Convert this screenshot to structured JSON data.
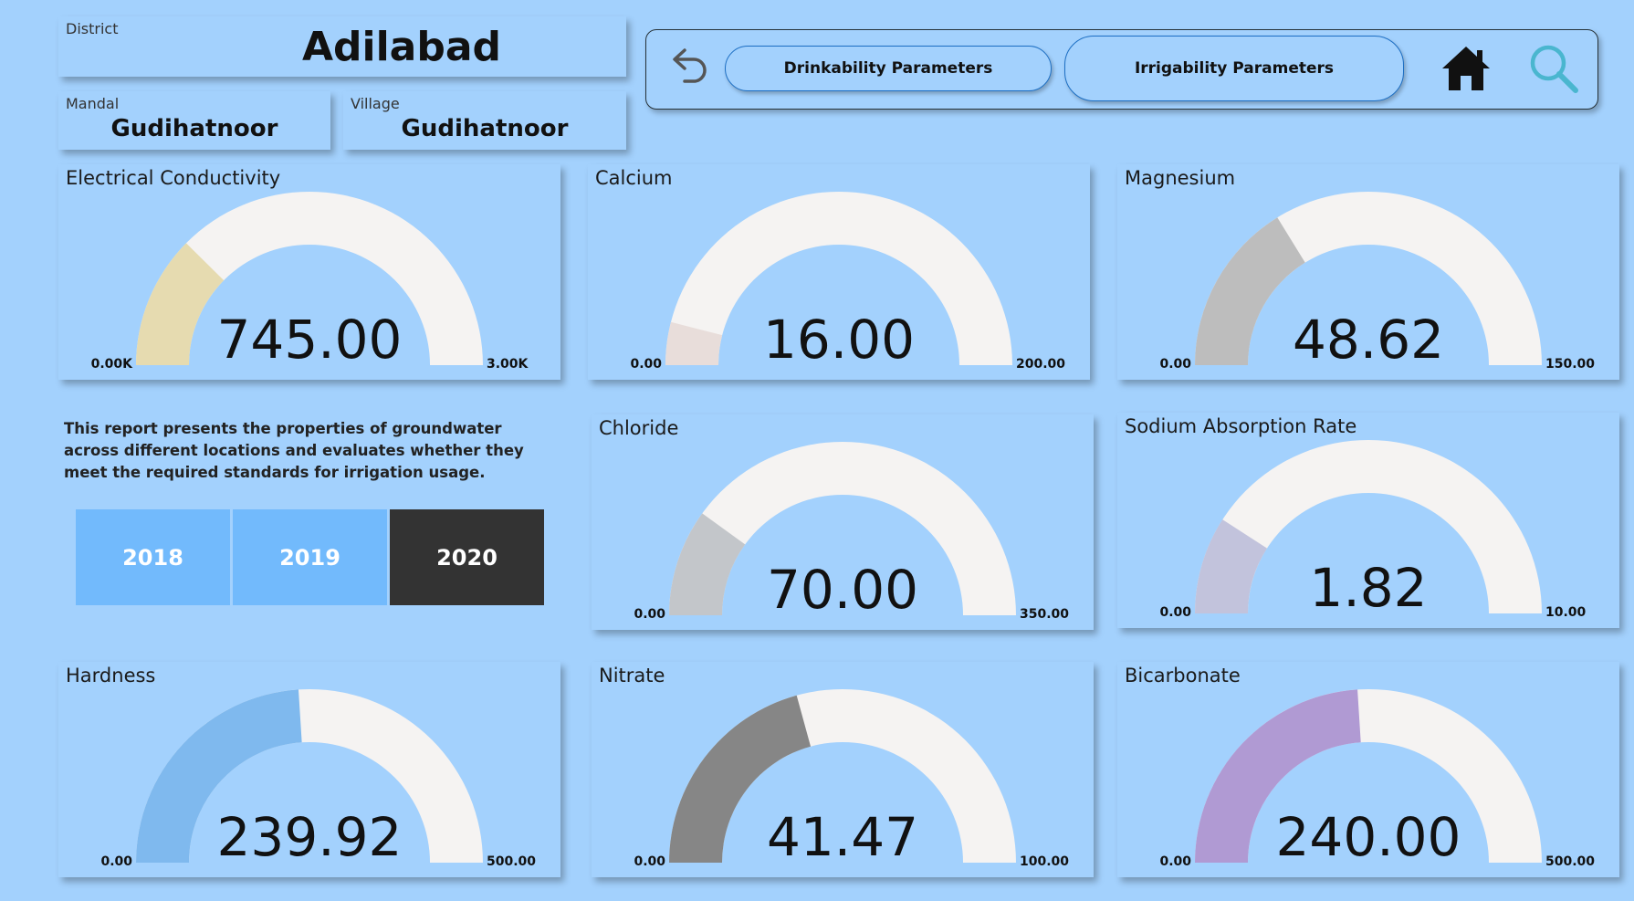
{
  "slicers": {
    "district": {
      "label": "District",
      "value": "Adilabad"
    },
    "mandal": {
      "label": "Mandal",
      "value": "Gudihatnoor"
    },
    "village": {
      "label": "Village",
      "value": "Gudihatnoor"
    }
  },
  "nav": {
    "back_icon": "undo-arrow-icon",
    "drinkability_label": "Drinkability Parameters",
    "irrigability_label": "Irrigability Parameters",
    "home_icon": "home-icon",
    "search_icon": "search-icon"
  },
  "description": "This report presents the properties of groundwater across different locations and evaluates whether they meet the required standards for irrigation usage.",
  "years": [
    {
      "label": "2018",
      "selected": false
    },
    {
      "label": "2019",
      "selected": false
    },
    {
      "label": "2020",
      "selected": true
    }
  ],
  "colors": {
    "background": "#a3d1fd",
    "gauge_track": "#f5f3f2",
    "year_unselected": "#72bafc",
    "year_selected": "#333333"
  },
  "gauges": [
    {
      "title": "Electrical Conductivity",
      "value": 745,
      "display": "745.00",
      "min": 0,
      "max": 3000,
      "min_label": "0.00K",
      "max_label": "3.00K",
      "color": "#e6dbb0"
    },
    {
      "title": "Calcium",
      "value": 16,
      "display": "16.00",
      "min": 0,
      "max": 200,
      "min_label": "0.00",
      "max_label": "200.00",
      "color": "#e8ddda"
    },
    {
      "title": "Magnesium",
      "value": 48.62,
      "display": "48.62",
      "min": 0,
      "max": 150,
      "min_label": "0.00",
      "max_label": "150.00",
      "color": "#bdbdbd"
    },
    {
      "title": "Chloride",
      "value": 70,
      "display": "70.00",
      "min": 0,
      "max": 350,
      "min_label": "0.00",
      "max_label": "350.00",
      "color": "#c3c6ca"
    },
    {
      "title": "Sodium Absorption Rate",
      "value": 1.82,
      "display": "1.82",
      "min": 0,
      "max": 10,
      "min_label": "0.00",
      "max_label": "10.00",
      "color": "#c2c3dc"
    },
    {
      "title": "Hardness",
      "value": 239.92,
      "display": "239.92",
      "min": 0,
      "max": 500,
      "min_label": "0.00",
      "max_label": "500.00",
      "color": "#7fb9ee"
    },
    {
      "title": "Nitrate",
      "value": 41.47,
      "display": "41.47",
      "min": 0,
      "max": 100,
      "min_label": "0.00",
      "max_label": "100.00",
      "color": "#868686"
    },
    {
      "title": "Bicarbonate",
      "value": 240,
      "display": "240.00",
      "min": 0,
      "max": 500,
      "min_label": "0.00",
      "max_label": "500.00",
      "color": "#b09ad3"
    }
  ]
}
